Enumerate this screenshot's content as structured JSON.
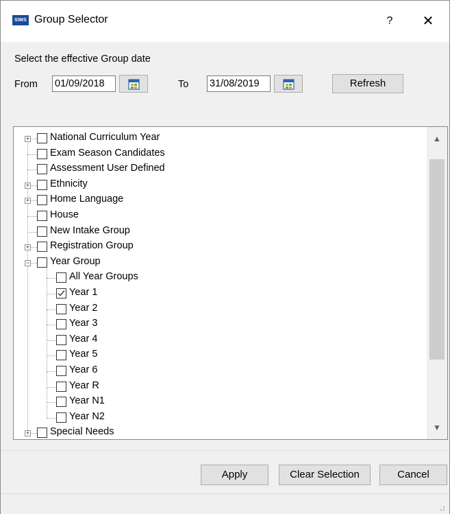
{
  "window": {
    "title": "Group Selector",
    "app_icon_text": "SIMS",
    "help_label": "?",
    "close_label": "✕"
  },
  "dates": {
    "prompt": "Select the effective Group date",
    "from_label": "From",
    "from_value": "01/09/2018",
    "to_label": "To",
    "to_value": "31/08/2019",
    "refresh_label": "Refresh"
  },
  "tree": {
    "items": [
      {
        "label": "National Curriculum Year",
        "expandable": true,
        "checked": false,
        "level": 0
      },
      {
        "label": "Exam Season Candidates",
        "expandable": false,
        "checked": false,
        "level": 0
      },
      {
        "label": "Assessment User Defined",
        "expandable": false,
        "checked": false,
        "level": 0
      },
      {
        "label": "Ethnicity",
        "expandable": true,
        "checked": false,
        "level": 0
      },
      {
        "label": "Home Language",
        "expandable": true,
        "checked": false,
        "level": 0
      },
      {
        "label": "House",
        "expandable": false,
        "checked": false,
        "level": 0
      },
      {
        "label": "New Intake Group",
        "expandable": false,
        "checked": false,
        "level": 0
      },
      {
        "label": "Registration Group",
        "expandable": true,
        "checked": false,
        "level": 0
      },
      {
        "label": "Year Group",
        "expandable": true,
        "expanded": true,
        "checked": false,
        "level": 0
      },
      {
        "label": "All Year Groups",
        "checked": false,
        "level": 1
      },
      {
        "label": "Year  1",
        "checked": true,
        "level": 1
      },
      {
        "label": "Year  2",
        "checked": false,
        "level": 1
      },
      {
        "label": "Year  3",
        "checked": false,
        "level": 1
      },
      {
        "label": "Year  4",
        "checked": false,
        "level": 1
      },
      {
        "label": "Year  5",
        "checked": false,
        "level": 1
      },
      {
        "label": "Year  6",
        "checked": false,
        "level": 1
      },
      {
        "label": "Year  R",
        "checked": false,
        "level": 1
      },
      {
        "label": "Year N1",
        "checked": false,
        "level": 1
      },
      {
        "label": "Year N2",
        "checked": false,
        "level": 1
      },
      {
        "label": "Special Needs",
        "expandable": true,
        "checked": false,
        "level": 0
      }
    ]
  },
  "buttons": {
    "apply": "Apply",
    "clear": "Clear Selection",
    "cancel": "Cancel"
  }
}
